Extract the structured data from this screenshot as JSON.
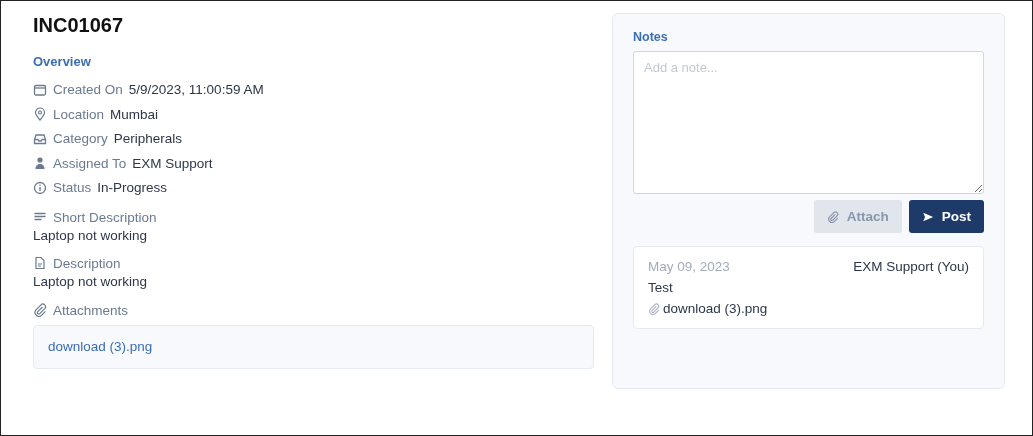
{
  "title": "INC01067",
  "section_title": "Overview",
  "fields": [
    {
      "kind": "calendar",
      "label": "Created On",
      "value": "5/9/2023, 11:00:59 AM"
    },
    {
      "kind": "location",
      "label": "Location",
      "value": "Mumbai"
    },
    {
      "kind": "tray",
      "label": "Category",
      "value": "Peripherals"
    },
    {
      "kind": "person",
      "label": "Assigned To",
      "value": "EXM Support"
    },
    {
      "kind": "status",
      "label": "Status",
      "value": "In-Progress"
    }
  ],
  "blocks": [
    {
      "kind": "lines",
      "label": "Short Description",
      "value": "Laptop not working"
    },
    {
      "kind": "document",
      "label": "Description",
      "value": "Laptop not working"
    }
  ],
  "attachments": {
    "label": "Attachments",
    "files": [
      "download (3).png"
    ]
  },
  "notes": {
    "label": "Notes",
    "placeholder": "Add a note...",
    "buttons": [
      {
        "kind": "attach",
        "label": "Attach",
        "disabled": true
      },
      {
        "kind": "post",
        "label": "Post",
        "disabled": false
      }
    ],
    "entries": [
      {
        "date": "May 09, 2023",
        "author": "EXM Support (You)",
        "text": "Test",
        "files": [
          "download (3).png"
        ]
      }
    ]
  }
}
